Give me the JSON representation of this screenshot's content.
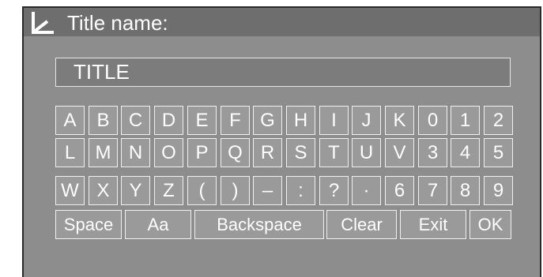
{
  "header": {
    "title": "Title name:",
    "icon": "return-arrow-icon"
  },
  "title_field": {
    "value": "TITLE"
  },
  "keyboard": {
    "rows": [
      [
        "A",
        "B",
        "C",
        "D",
        "E",
        "F",
        "G",
        "H",
        "I",
        "J",
        "K",
        "0",
        "1",
        "2"
      ],
      [
        "L",
        "M",
        "N",
        "O",
        "P",
        "Q",
        "R",
        "S",
        "T",
        "U",
        "V",
        "3",
        "4",
        "5"
      ],
      [
        "W",
        "X",
        "Y",
        "Z",
        "(",
        ")",
        "–",
        ":",
        "?",
        "·",
        "6",
        "7",
        "8",
        "9"
      ]
    ],
    "function_keys": [
      "Space",
      "Aa",
      "Backspace",
      "Clear",
      "Exit",
      "OK"
    ]
  },
  "colors": {
    "panel": "#8d8d8d",
    "header": "#6e6e6e",
    "key": "#9a9a9a",
    "key_border": "#f0f0f0",
    "text": "#ffffff"
  }
}
